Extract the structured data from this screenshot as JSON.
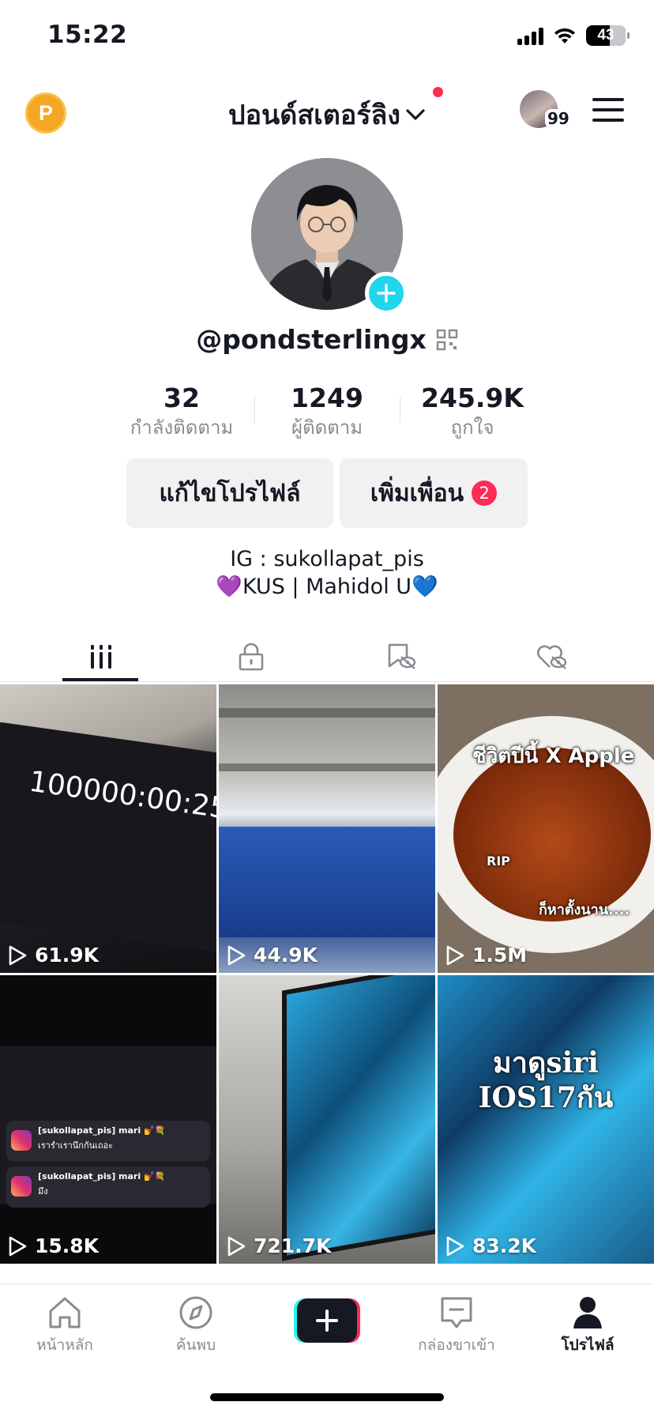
{
  "status_bar": {
    "time": "15:22",
    "battery": "43"
  },
  "header": {
    "coin_label": "P",
    "title": "ปอนด์สเตอร์ลิง",
    "account_switch_count": "99"
  },
  "profile": {
    "handle": "@pondsterlingx",
    "stats": [
      {
        "value": "32",
        "label": "กำลังติดตาม"
      },
      {
        "value": "1249",
        "label": "ผู้ติดตาม"
      },
      {
        "value": "245.9K",
        "label": "ถูกใจ"
      }
    ],
    "edit_button": "แก้ไขโปรไฟล์",
    "add_friends_button": "เพิ่มเพื่อน",
    "add_friends_badge": "2",
    "bio_line1": "IG : sukollapat_pis",
    "bio_line2": "💜KUS | Mahidol U💙"
  },
  "tabs": [
    "videos-grid-icon",
    "private-lock-icon",
    "saved-bookmark-icon",
    "liked-heart-icon"
  ],
  "videos": [
    {
      "views": "61.9K",
      "overlay": "100000:00:25"
    },
    {
      "views": "44.9K",
      "overlay": ""
    },
    {
      "views": "1.5M",
      "overlay": "ชีวิตปีนี้ X Apple",
      "overlay2": "RIP",
      "overlay3": "ก็หาตั้งนาน...."
    },
    {
      "views": "15.8K",
      "overlay": "[sukollapat_pis] mari 💅💐",
      "overlay2": "เรารำเรานึกกันเถอะ",
      "overlay3": "[sukollapat_pis] mari 💅💐",
      "overlay4": "มึง"
    },
    {
      "views": "721.7K",
      "overlay": ""
    },
    {
      "views": "83.2K",
      "overlay": "มาดูsiri",
      "overlay2": "IOS17กัน"
    }
  ],
  "nav": {
    "home": "หน้าหลัก",
    "discover": "ค้นพบ",
    "inbox": "กล่องขาเข้า",
    "profile": "โปรไฟล์"
  },
  "colors": {
    "accent": "#fe2c55",
    "cyan": "#20d5ec",
    "coin": "#f5a623"
  }
}
